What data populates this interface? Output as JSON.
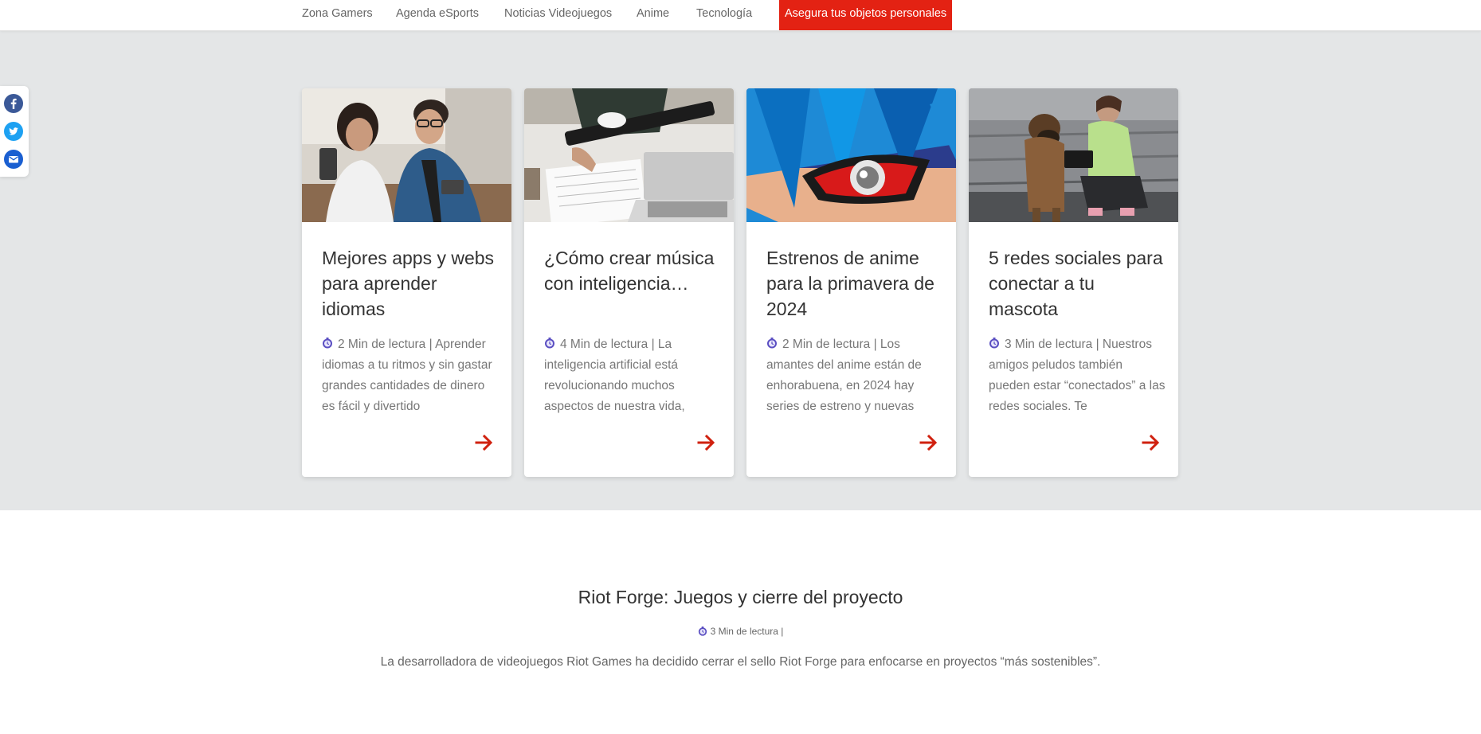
{
  "nav": {
    "items": [
      {
        "label": "Zona Gamers"
      },
      {
        "label": "Agenda eSports"
      },
      {
        "label": "Noticias Videojuegos"
      },
      {
        "label": "Anime"
      },
      {
        "label": "Tecnología"
      },
      {
        "label": "Asegura tus objetos personales",
        "highlight": true
      }
    ]
  },
  "social": {
    "icons": [
      "facebook-icon",
      "twitter-icon",
      "email-icon"
    ],
    "colors": {
      "facebook": "#3b5998",
      "twitter": "#1da1f2",
      "email": "#1a5fd1"
    }
  },
  "cards": [
    {
      "title": "Mejores apps y webs para aprender idiomas",
      "meta": "2 Min de lectura | Aprender idiomas a tu ritmos y sin gastar grandes cantidades de dinero es fácil y divertido",
      "image": "people-with-phones-photo"
    },
    {
      "title": "¿Cómo crear música con inteligencia…",
      "meta": "4 Min de lectura | La inteligencia artificial está revolucionando muchos aspectos de nuestra vida,",
      "image": "guitarist-with-laptop-photo"
    },
    {
      "title": "Estrenos de anime para la primavera de 2024",
      "meta": "2 Min de lectura | Los amantes del anime están de enhorabuena, en 2024 hay series de estreno y nuevas",
      "image": "anime-eye-illustration"
    },
    {
      "title": "5 redes sociales para conectar a tu mascota",
      "meta": "3 Min de lectura | Nuestros amigos peludos también pueden estar “conectados” a las redes sociales. Te",
      "image": "woman-with-dog-photo"
    }
  ],
  "article": {
    "title": "Riot Forge: Juegos y cierre del proyecto",
    "meta": "3 Min de lectura |",
    "excerpt": "La desarrolladora de videojuegos Riot Games ha decidido cerrar el sello Riot Forge para enfocarse en proyectos “más sostenibles”."
  },
  "colors": {
    "accent": "#e32213",
    "clock": "#5b4fc2",
    "grey_section": "#e4e6e7"
  }
}
